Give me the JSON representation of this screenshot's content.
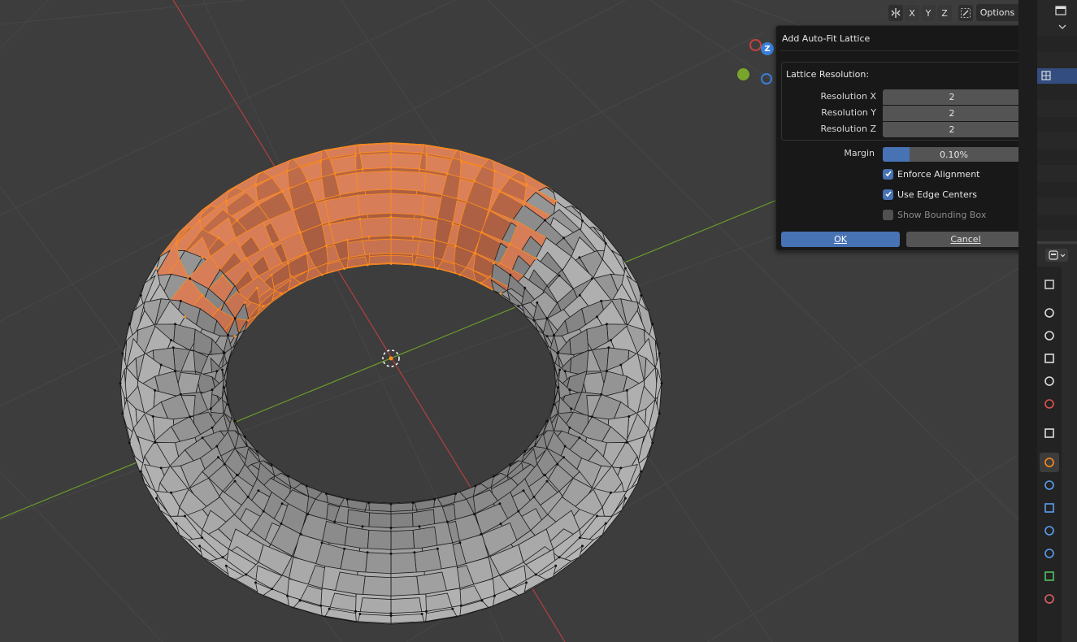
{
  "header": {
    "axis_buttons": [
      "X",
      "Y",
      "Z"
    ],
    "options_label": "Options",
    "icons": [
      "mirror-icon",
      "snap-icon",
      "chevron-down-icon"
    ]
  },
  "gizmo": {
    "z_label": "Z"
  },
  "dialog": {
    "title": "Add Auto-Fit Lattice",
    "section_label": "Lattice Resolution:",
    "resolution": [
      {
        "label": "Resolution X",
        "value": "2"
      },
      {
        "label": "Resolution Y",
        "value": "2"
      },
      {
        "label": "Resolution Z",
        "value": "2"
      }
    ],
    "margin": {
      "label": "Margin",
      "value": "0.10%",
      "fill_fraction": 0.19
    },
    "checkboxes": [
      {
        "label": "Enforce Alignment",
        "checked": true,
        "enabled": true
      },
      {
        "label": "Use Edge Centers",
        "checked": true,
        "enabled": true
      },
      {
        "label": "Show Bounding Box",
        "checked": false,
        "enabled": false
      }
    ],
    "ok_label": "OK",
    "cancel_label": "Cancel"
  },
  "colors": {
    "accent": "#4772b3",
    "selection": "#ff8c1a",
    "x_axis": "#b34040",
    "y_axis": "#6a9a2a"
  },
  "properties_tabs": [
    "tool-icon",
    "render-icon",
    "output-icon",
    "view-layer-icon",
    "scene-icon",
    "world-icon",
    "collection-icon",
    "object-icon",
    "modifier-icon",
    "particles-icon",
    "physics-icon",
    "constraints-icon",
    "data-icon",
    "material-icon"
  ]
}
